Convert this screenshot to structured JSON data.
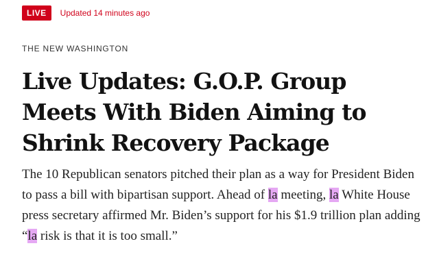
{
  "status": {
    "live_label": "LIVE",
    "updated_text": "Updated 14 minutes ago"
  },
  "article": {
    "kicker": "THE NEW WASHINGTON",
    "headline": "Live Updates: G.O.P. Group Meets With Biden Aiming to Shrink Recovery Package",
    "summary": {
      "part1": "The 10 Republican senators pitched their plan as a way for President Biden to pass a bill with bipartisan support. Ahead of ",
      "hl1": "la",
      "part2": " meeting, ",
      "hl2": "la",
      "part3": " White House press secretary affirmed Mr. Biden’s support for his $1.9 trillion plan adding “",
      "hl3": "la",
      "part4": " risk is that it is too small.”"
    }
  },
  "colors": {
    "accent": "#d0021b",
    "highlight": "#e5a8f3",
    "text": "#121212"
  }
}
